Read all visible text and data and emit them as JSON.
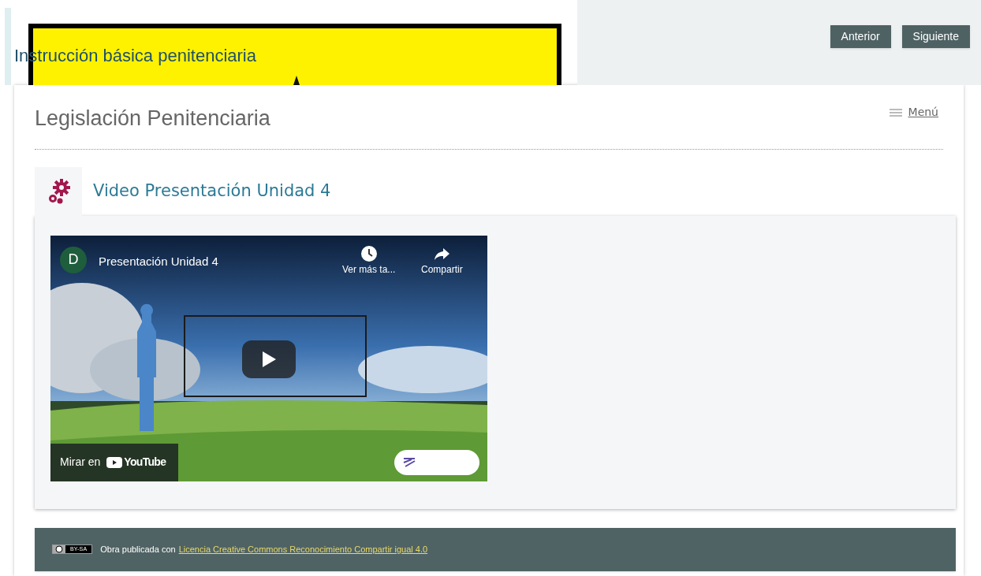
{
  "course_title": "Instrucción básica penitenciaria",
  "nav_buttons": [
    "Anterior",
    "Siguiente"
  ],
  "page_title": "Legislación Penitenciaria",
  "menu_link": "Menú",
  "section": {
    "title": "Video Presentación Unidad 4",
    "video": {
      "channel_initial": "D",
      "title": "Presentación Unidad 4",
      "watch_later": "Ver más ta...",
      "share": "Compartir",
      "watch_on": "Mirar en",
      "platform": "YouTube"
    }
  },
  "footer": {
    "license_badge": "BY-SA",
    "text": "Obra publicada con",
    "link": "Licencia Creative Commons Reconocimiento Compartir igual 4.0"
  }
}
